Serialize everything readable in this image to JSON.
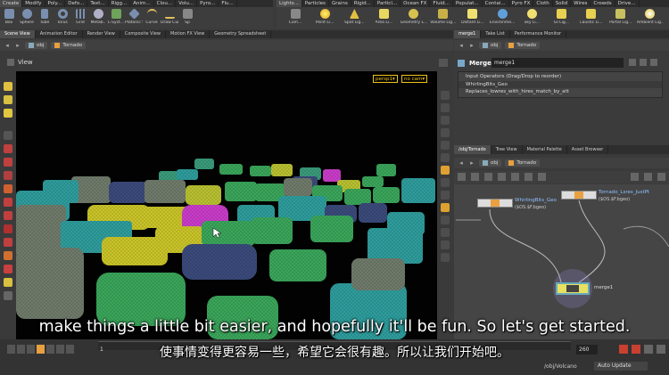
{
  "shelf_left": {
    "tabs": [
      "Create",
      "Modify",
      "Poly...",
      "Defo...",
      "Text...",
      "Rigg...",
      "Anim...",
      "Clou...",
      "Volu...",
      "Pyro...",
      "Flu..."
    ],
    "tools": [
      "Box",
      "Sphere",
      "Tube",
      "Torus",
      "Grid",
      "Metab..",
      "L-Syst...",
      "Platonic Sol...",
      "Curve",
      "Draw Cur...",
      "Sp"
    ]
  },
  "shelf_right": {
    "tabs": [
      "Lights...",
      "Particles",
      "Grains",
      "Rigid...",
      "Particl...",
      "Ocean FX",
      "Fluid...",
      "Populat...",
      "Contai...",
      "Pyro FX",
      "Cloth",
      "Solid",
      "Wires",
      "Crowds",
      "Drive..."
    ],
    "tools": [
      "Cam...",
      "Point Li...",
      "Spot Lig...",
      "Area Li...",
      "Geometry L...",
      "Volume Lig...",
      "Distant Li...",
      "Environme...",
      "Sky Li...",
      "GI Lig...",
      "Caustic Li...",
      "Portal Lig...",
      "Ambient Lig..."
    ]
  },
  "left_pane": {
    "tabs": [
      "Scene View",
      "Animation Editor",
      "Render View",
      "Composite View",
      "Motion FX View",
      "Geometry Spreadsheet"
    ],
    "path": {
      "root": "obj",
      "node": "Tornado"
    },
    "view_label": "View",
    "camera_menu": "persp1▾",
    "cam_menu": "no cam▾"
  },
  "parm_pane": {
    "tabs": [
      "merge1",
      "Take List",
      "Performance Monitor"
    ],
    "path": {
      "root": "obj",
      "node": "Tornado"
    },
    "node_type": "Merge",
    "node_name": "merge1",
    "header": "Input Operators (Drag/Drop to reorder)",
    "inputs": [
      "WhirlingBits_Geo",
      "Replaces_lowres_with_hires_match_by_att"
    ]
  },
  "network_pane": {
    "tabs": [
      "/obj/Tornado",
      "Tree View",
      "Material Palette",
      "Asset Browser"
    ],
    "path": {
      "root": "obj",
      "node": "Tornado"
    },
    "nodes": [
      {
        "name": "WhirlingBits_Geo",
        "sub": "($OS.$F.bgeo)"
      },
      {
        "name": "Tornado_Lsres_JustPt",
        "sub": "($OS.$F.bgeo)"
      },
      {
        "name": "merge1",
        "sub": ""
      }
    ]
  },
  "timeline": {
    "current_frame": "1",
    "end_frame": "260",
    "path": "/obj/Volcano",
    "update_mode": "Auto Update"
  },
  "subtitles": {
    "english": "make things a little bit easier, and hopefully it'll be fun. So let's get started.",
    "chinese": "使事情变得更容易一些，希望它会很有趣。所以让我们开始吧。"
  },
  "colors": {
    "accent_yellow": "#f0c419",
    "car_green": "#3aa55a",
    "car_teal": "#2e9c9c",
    "car_yellow": "#c9c428",
    "car_magenta": "#c83cc8",
    "car_navy": "#3a4a7a",
    "car_gray": "#6f7a6a"
  }
}
